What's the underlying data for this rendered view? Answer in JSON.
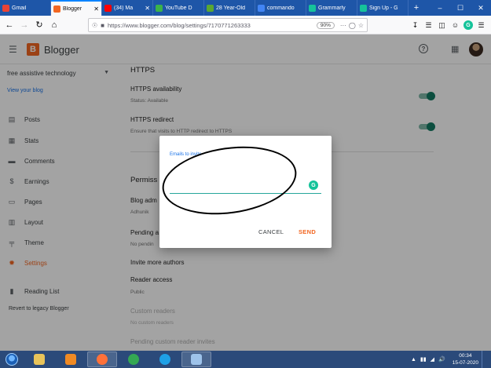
{
  "browser": {
    "tabs": [
      {
        "title": "Gmail",
        "color": "#ea4335",
        "active": false,
        "closable": false
      },
      {
        "title": "Blogger",
        "color": "#f26722",
        "active": true,
        "closable": true
      },
      {
        "title": "(34) Ma",
        "color": "#ff0000",
        "active": false,
        "closable": true
      },
      {
        "title": "YouTube D",
        "color": "#3bb34a",
        "active": false,
        "closable": false
      },
      {
        "title": "28 Year-Old",
        "color": "#5aa832",
        "active": false,
        "closable": false
      },
      {
        "title": "commando",
        "color": "#4285f4",
        "active": false,
        "closable": false
      },
      {
        "title": "Grammarly",
        "color": "#15c39a",
        "active": false,
        "closable": false
      },
      {
        "title": "Sign Up - G",
        "color": "#15c39a",
        "active": false,
        "closable": false
      }
    ],
    "new_tab": "+",
    "window_controls": [
      "–",
      "☐",
      "✕"
    ],
    "url": "https://www.blogger.com/blog/settings/7170771263333",
    "zoom": "90%",
    "more": "···"
  },
  "app": {
    "name": "Blogger",
    "logo_letter": "B",
    "help": "?",
    "apps": "⋮⋮⋮"
  },
  "sidebar": {
    "blog_name": "free assistive technology",
    "view_blog": "View your blog",
    "items": [
      {
        "label": "Posts",
        "icon": "▤"
      },
      {
        "label": "Stats",
        "icon": "▦"
      },
      {
        "label": "Comments",
        "icon": "▬"
      },
      {
        "label": "Earnings",
        "icon": "$"
      },
      {
        "label": "Pages",
        "icon": "▭"
      },
      {
        "label": "Layout",
        "icon": "▥"
      },
      {
        "label": "Theme",
        "icon": "╤"
      },
      {
        "label": "Settings",
        "icon": "✹"
      }
    ],
    "reading_list": "Reading List",
    "reading_icon": "▮",
    "revert": "Revert to legacy Blogger"
  },
  "main": {
    "https_title": "HTTPS",
    "https_availability": "HTTPS availability",
    "https_status": "Status: Available",
    "https_redirect": "HTTPS redirect",
    "https_redirect_desc": "Ensure that visits to HTTP redirect to HTTPS",
    "permissions_title": "Permiss",
    "blog_admins": "Blog adm",
    "admin_name": "Adhunik",
    "pending": "Pending a",
    "no_pending": "No pendin",
    "invite_more": "Invite more authors",
    "reader_access": "Reader access",
    "reader_value": "Public",
    "custom_readers": "Custom readers",
    "no_custom_readers": "No custom readers",
    "pending_readers": "Pending custom reader invites"
  },
  "dialog": {
    "label": "Emails to invite",
    "value": "",
    "cancel": "CANCEL",
    "send": "SEND",
    "grammarly": "G"
  },
  "taskbar": {
    "apps": [
      {
        "name": "explorer",
        "color": "#e8c35a",
        "open": false
      },
      {
        "name": "media",
        "color": "#f08a24",
        "open": false
      },
      {
        "name": "firefox",
        "color": "#ff7139",
        "open": true
      },
      {
        "name": "chrome",
        "color": "#34a853",
        "open": false
      },
      {
        "name": "ie",
        "color": "#1ea0e6",
        "open": false
      },
      {
        "name": "photos",
        "color": "#9ec3ea",
        "open": true
      }
    ],
    "time": "00:34",
    "date": "15-07-2020",
    "tray": [
      "▲",
      "▮▮",
      "◢",
      "🔊"
    ]
  }
}
